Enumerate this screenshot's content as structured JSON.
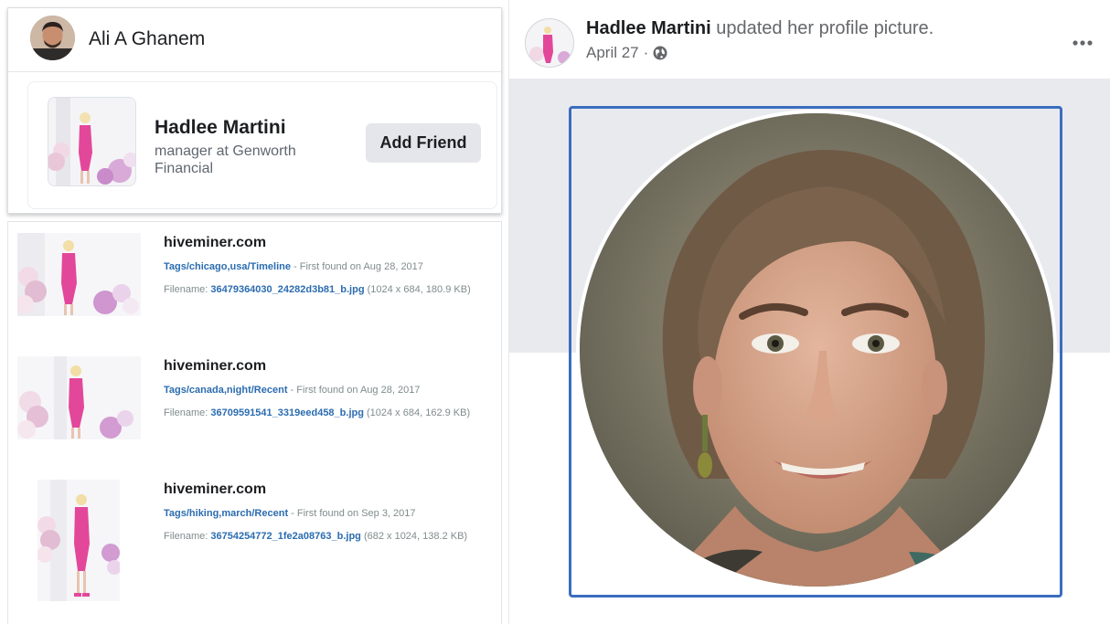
{
  "left": {
    "user": {
      "name": "Ali A Ghanem",
      "avatar_icon": "user-avatar-photo"
    },
    "suggestion": {
      "name": "Hadlee Martini",
      "subtitle": "manager at Genworth Financial",
      "add_friend_label": "Add Friend"
    },
    "results": [
      {
        "site": "hiveminer.com",
        "tags": "Tags/chicago,usa/Timeline",
        "found": " - First found on Aug 28, 2017",
        "filename_label": "Filename: ",
        "filename": "36479364030_24282d3b81_b.jpg",
        "details": " (1024 x 684, 180.9 KB)"
      },
      {
        "site": "hiveminer.com",
        "tags": "Tags/canada,night/Recent",
        "found": " - First found on Aug 28, 2017",
        "filename_label": "Filename: ",
        "filename": "36709591541_3319eed458_b.jpg",
        "details": " (1024 x 684, 162.9 KB)"
      },
      {
        "site": "hiveminer.com",
        "tags": "Tags/hiking,march/Recent",
        "found": " - First found on Sep 3, 2017",
        "filename_label": "Filename: ",
        "filename": "36754254772_1fe2a08763_b.jpg",
        "details": " (682 x 1024, 138.2 KB)"
      }
    ]
  },
  "post": {
    "author": "Hadlee Martini",
    "action": " updated her profile picture.",
    "date": "April 27",
    "separator": "·",
    "privacy_icon": "globe-icon",
    "menu_icon": "more-horizontal-icon"
  },
  "colors": {
    "link_blue": "#2b6cb0",
    "frame_blue": "#3b6dbf",
    "dress_pink": "#e3479a",
    "cover_gray": "#e9eaee"
  }
}
